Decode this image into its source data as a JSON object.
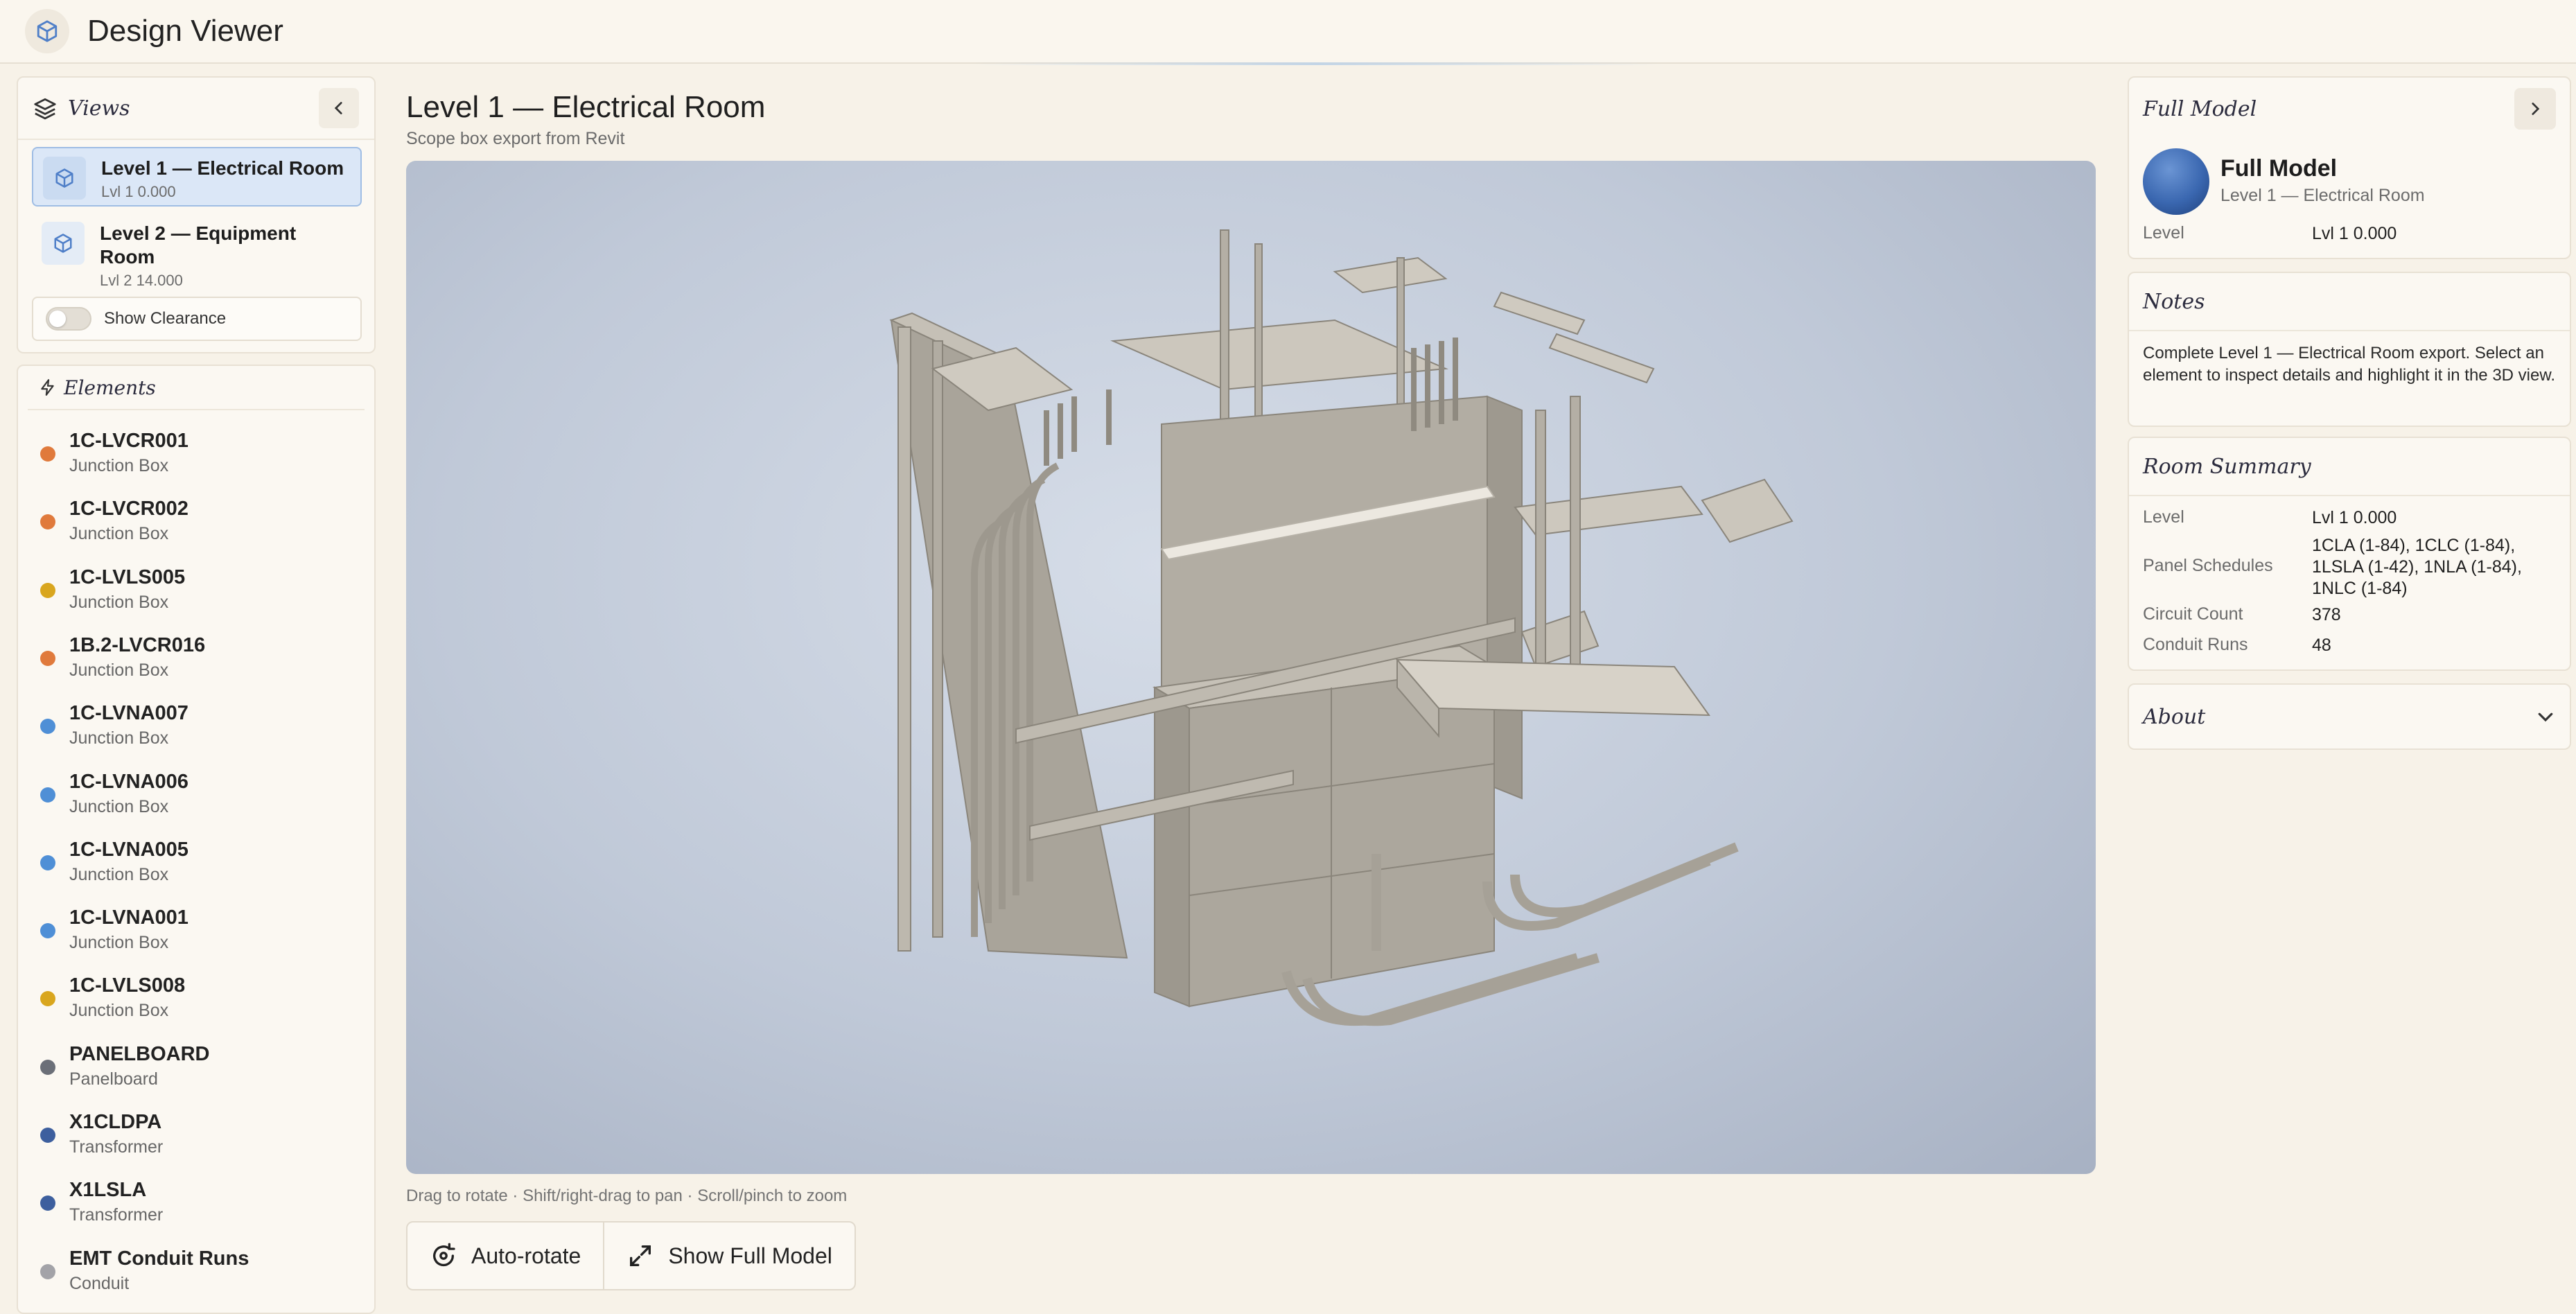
{
  "app": {
    "title": "Design Viewer"
  },
  "views_panel": {
    "title": "Views",
    "items": [
      {
        "name": "Level 1 — Electrical Room",
        "level": "Lvl 1 0.000",
        "active": true
      },
      {
        "name": "Level 2 — Equipment Room",
        "level": "Lvl 2 14.000",
        "active": false
      }
    ],
    "toggle_label": "Show Clearance"
  },
  "elements_panel": {
    "title": "Elements",
    "items": [
      {
        "name": "1C-LVCR001",
        "type": "Junction Box",
        "color": "#e07a3c"
      },
      {
        "name": "1C-LVCR002",
        "type": "Junction Box",
        "color": "#e07a3c"
      },
      {
        "name": "1C-LVLS005",
        "type": "Junction Box",
        "color": "#d9a61e"
      },
      {
        "name": "1B.2-LVCR016",
        "type": "Junction Box",
        "color": "#e07a3c"
      },
      {
        "name": "1C-LVNA007",
        "type": "Junction Box",
        "color": "#4f8fd6"
      },
      {
        "name": "1C-LVNA006",
        "type": "Junction Box",
        "color": "#4f8fd6"
      },
      {
        "name": "1C-LVNA005",
        "type": "Junction Box",
        "color": "#4f8fd6"
      },
      {
        "name": "1C-LVNA001",
        "type": "Junction Box",
        "color": "#4f8fd6"
      },
      {
        "name": "1C-LVLS008",
        "type": "Junction Box",
        "color": "#d9a61e"
      },
      {
        "name": "PANELBOARD",
        "type": "Panelboard",
        "color": "#6b6f78"
      },
      {
        "name": "X1CLDPA",
        "type": "Transformer",
        "color": "#3d5f9e"
      },
      {
        "name": "X1LSLA",
        "type": "Transformer",
        "color": "#3d5f9e"
      },
      {
        "name": "EMT Conduit Runs",
        "type": "Conduit",
        "color": "#a3a3a8"
      }
    ]
  },
  "main": {
    "title": "Level 1 — Electrical Room",
    "subtitle": "Scope box export from Revit",
    "hint": "Drag to rotate · Shift/right-drag to pan · Scroll/pinch to zoom",
    "buttons": {
      "auto_rotate": "Auto-rotate",
      "show_full_model": "Show Full Model"
    }
  },
  "full_model_panel": {
    "title": "Full Model",
    "name": "Full Model",
    "subtitle": "Level 1 — Electrical Room",
    "level_key": "Level",
    "level_value": "Lvl 1 0.000"
  },
  "notes_panel": {
    "title": "Notes",
    "text": "Complete Level 1 — Electrical Room export. Select an element to inspect details and highlight it in the 3D view."
  },
  "room_summary": {
    "title": "Room Summary",
    "rows": [
      {
        "key": "Level",
        "value": "Lvl 1 0.000"
      },
      {
        "key": "Panel Schedules",
        "value": "1CLA (1-84), 1CLC (1-84), 1LSLA (1-42), 1NLA (1-84), 1NLC (1-84)"
      },
      {
        "key": "Circuit Count",
        "value": "378"
      },
      {
        "key": "Conduit Runs",
        "value": "48"
      }
    ]
  },
  "about_panel": {
    "title": "About"
  },
  "colors": {
    "accent": "#4f7fc8",
    "active_view_bg": "#dbe7f7",
    "background": "#f7f2e8"
  }
}
